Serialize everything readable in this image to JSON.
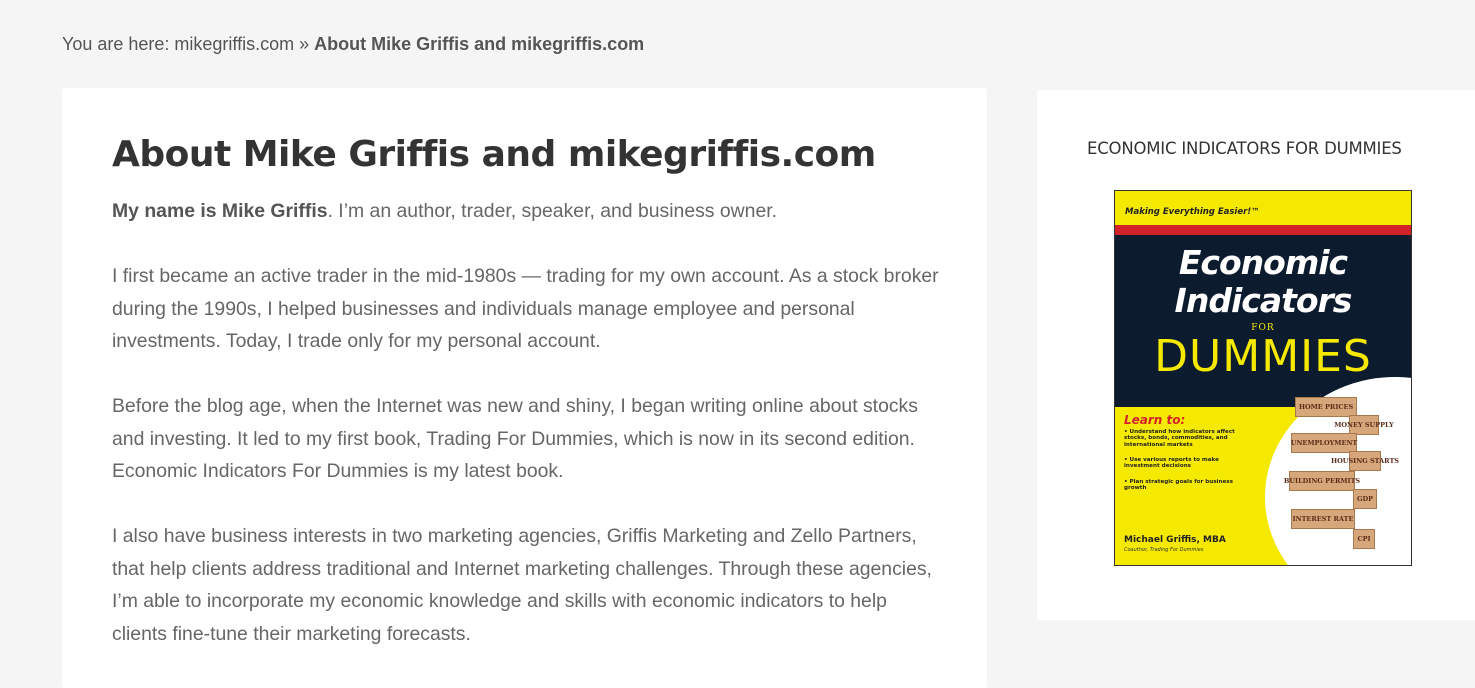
{
  "breadcrumb": {
    "prefix": "You are here: ",
    "home_link": "mikegriffis.com",
    "separator": " » ",
    "current": "About Mike Griffis and mikegriffis.com"
  },
  "article": {
    "title": "About Mike Griffis and mikegriffis.com",
    "p1_bold": "My name is Mike Griffis",
    "p1_rest": ". I’m an author, trader, speaker, and business owner.",
    "p2": "I first became an active trader in the mid-1980s — trading for my own account. As a stock broker during the 1990s, I helped businesses and individuals manage employee and personal investments. Today, I trade only for my personal account.",
    "p3": "Before the blog age, when the Internet was new and shiny, I began writing online about stocks and investing. It led to my first book, Trading For Dummies, which is now in its second edition. Economic Indicators For Dummies is my latest book.",
    "p4": "I also have business interests in two marketing agencies, Griffis Marketing and Zello Partners, that help clients address traditional and Internet marketing challenges. Through these agencies, I’m able to incorporate my economic knowledge and skills with economic indicators to help clients fine-tune their marketing forecasts."
  },
  "sidebar": {
    "widget_title": "ECONOMIC INDICATORS FOR DUMMIES",
    "book": {
      "tagline": "Making Everything Easier!™",
      "title_line1": "Economic",
      "title_line2": "Indicators",
      "for": "FOR",
      "dummies": "DUMMIES",
      "learn_to": "Learn to:",
      "bullets": [
        "• Understand how indicators affect stocks, bonds, commodities, and international markets",
        "• Use various reports to make investment decisions",
        "• Plan strategic goals for business growth"
      ],
      "blocks": [
        "HOME PRICES",
        "MONEY SUPPLY",
        "UNEMPLOYMENT",
        "HOUSING STARTS",
        "BUILDING PERMITS",
        "GDP",
        "INTEREST RATE",
        "CPI"
      ],
      "author": "Michael Griffis, MBA",
      "coauthor": "Coauthor, Trading For Dummies",
      "colors": {
        "yellow": "#f5e900",
        "navy": "#0d1b2e",
        "red": "#d3222a"
      }
    }
  }
}
